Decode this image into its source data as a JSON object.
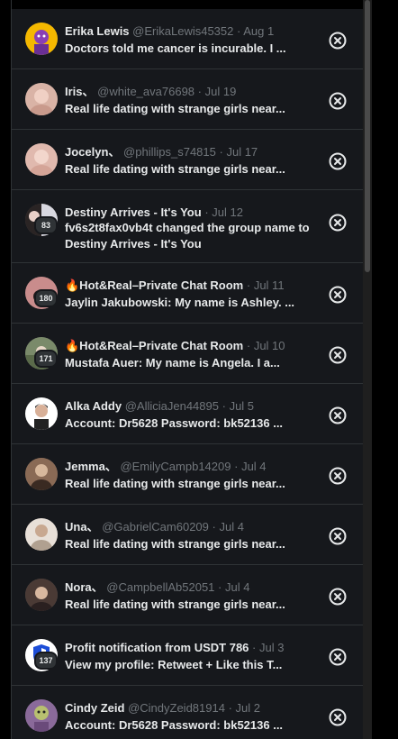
{
  "conversations": [
    {
      "name": "Erika Lewis",
      "handle": "@ErikaLewis45352",
      "separator": "·",
      "date": "Aug 1",
      "preview": "Doctors told me cancer is incurable. I ...",
      "avatar_icon": "cartoon-avatar-icon",
      "colors": {
        "bg": "#f5b800"
      }
    },
    {
      "name": "Iris、",
      "handle": "@white_ava76698",
      "separator": "·",
      "date": "Jul 19",
      "preview": "Real life dating with strange girls near...",
      "avatar_icon": "person-photo-icon",
      "colors": {
        "bg": "#d9b3a6"
      }
    },
    {
      "name": "Jocelyn、",
      "handle": "@phillips_s74815",
      "separator": "·",
      "date": "Jul 17",
      "preview": "Real life dating with strange girls near...",
      "avatar_icon": "person-photo-icon",
      "colors": {
        "bg": "#e0b9ae"
      }
    },
    {
      "name": "Destiny Arrives - It's You",
      "handle": "",
      "separator": "·",
      "date": "Jul 12",
      "preview": "fv6s2t8fax0vb4t changed the group name to Destiny Arrives - It's You",
      "badge": "83",
      "avatar_icon": "group-photo-icon",
      "colors": {
        "bg": "#3a3030"
      }
    },
    {
      "name": "🔥Hot&Real–Private Chat Room",
      "handle": "",
      "separator": "·",
      "date": "Jul 11",
      "preview": "Jaylin Jakubowski: My name is Ashley. ...",
      "badge": "180",
      "avatar_icon": "group-photo-icon",
      "colors": {
        "bg": "#c98c8c"
      }
    },
    {
      "name": "🔥Hot&Real–Private Chat Room",
      "handle": "",
      "separator": "·",
      "date": "Jul 10",
      "preview": "Mustafa Auer: My name is Angela. I a...",
      "badge": "171",
      "avatar_icon": "group-photo-icon",
      "colors": {
        "bg": "#7a8a6a"
      }
    },
    {
      "name": "Alka Addy",
      "handle": "@AlliciaJen44895",
      "separator": "·",
      "date": "Jul 5",
      "preview": "Account: Dr5628 Password: bk52136 ...",
      "avatar_icon": "cartoon-avatar-icon",
      "colors": {
        "bg": "#ffffff"
      }
    },
    {
      "name": "Jemma、",
      "handle": "@EmilyCampb14209",
      "separator": "·",
      "date": "Jul 4",
      "preview": "Real life dating with strange girls near...",
      "avatar_icon": "person-photo-icon",
      "colors": {
        "bg": "#8a6a55"
      }
    },
    {
      "name": "Una、",
      "handle": "@GabrielCam60209",
      "separator": "·",
      "date": "Jul 4",
      "preview": "Real life dating with strange girls near...",
      "avatar_icon": "person-photo-icon",
      "colors": {
        "bg": "#e8e0d8"
      }
    },
    {
      "name": "Nora、",
      "handle": "@CampbellAb52051",
      "separator": "·",
      "date": "Jul 4",
      "preview": "Real life dating with strange girls near...",
      "avatar_icon": "person-photo-icon",
      "colors": {
        "bg": "#4a3a35"
      }
    },
    {
      "name": "Profit notification from USDT 786",
      "handle": "",
      "separator": "·",
      "date": "Jul 3",
      "preview": "View my profile: Retweet + Like this T...",
      "badge": "137",
      "avatar_icon": "shield-logo-icon",
      "colors": {
        "bg": "#ffffff"
      }
    },
    {
      "name": "Cindy Zeid",
      "handle": "@CindyZeid81914",
      "separator": "·",
      "date": "Jul 2",
      "preview": "Account: Dr5628 Password: bk52136 ...",
      "avatar_icon": "cartoon-avatar-icon",
      "colors": {
        "bg": "#8a6a9a"
      }
    }
  ],
  "close_icon": "close-circle-icon",
  "colors": {
    "panel_bg": "#16181c",
    "divider": "#2f3336",
    "text_primary": "#e7e9ea",
    "text_secondary": "#71767b"
  }
}
